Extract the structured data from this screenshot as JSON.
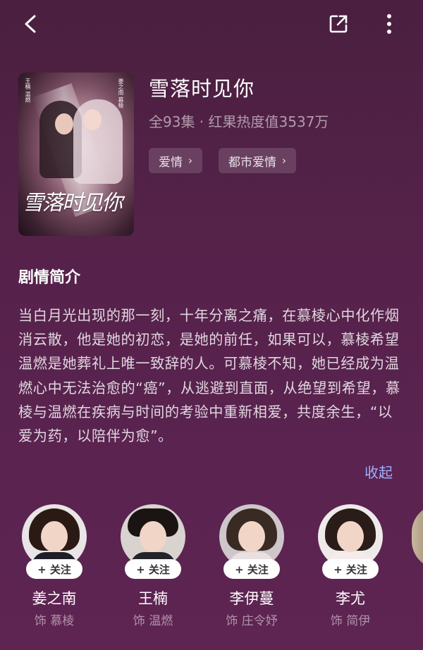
{
  "icons": {
    "back": "chevron-left-icon",
    "share": "share-icon",
    "more": "more-vertical-icon"
  },
  "show": {
    "title": "雪落时见你",
    "meta": "全93集 · 红果热度值3537万",
    "tags": [
      "爱情",
      "都市爱情"
    ],
    "poster_logo": "雪落时见你",
    "poster_credits": [
      "姜之南 慕棱",
      "王楠 温燃"
    ]
  },
  "synopsis": {
    "heading": "剧情简介",
    "text": "当白月光出现的那一刻，十年分离之痛，在慕棱心中化作烟消云散，他是她的初恋，是她的前任，如果可以，慕棱希望温燃是她葬礼上唯一致辞的人。可慕棱不知，她已经成为温燃心中无法治愈的“癌”，从逃避到直面，从绝望到希望，慕棱与温燃在疾病与时间的考验中重新相爱，共度余生，“以爱为药，以陪伴为愈”。",
    "collapse_label": "收起"
  },
  "cast": [
    {
      "name": "姜之南",
      "role": "饰 慕棱",
      "follow": "+ 关注",
      "hair": "#2b1a14",
      "body": "#1e1e26"
    },
    {
      "name": "王楠",
      "role": "饰 温燃",
      "follow": "+ 关注",
      "hair": "#1a1412",
      "body": "#25232a"
    },
    {
      "name": "李伊蔓",
      "role": "饰 庄令妤",
      "follow": "+ 关注",
      "hair": "#3a2a24",
      "body": "#e8e1e0"
    },
    {
      "name": "李尤",
      "role": "饰 简伊",
      "follow": "+ 关注",
      "hair": "#2a1c18",
      "body": "#f3ecea"
    }
  ],
  "colors": {
    "accent_link": "#9fb0ff",
    "background": "#55224a"
  }
}
